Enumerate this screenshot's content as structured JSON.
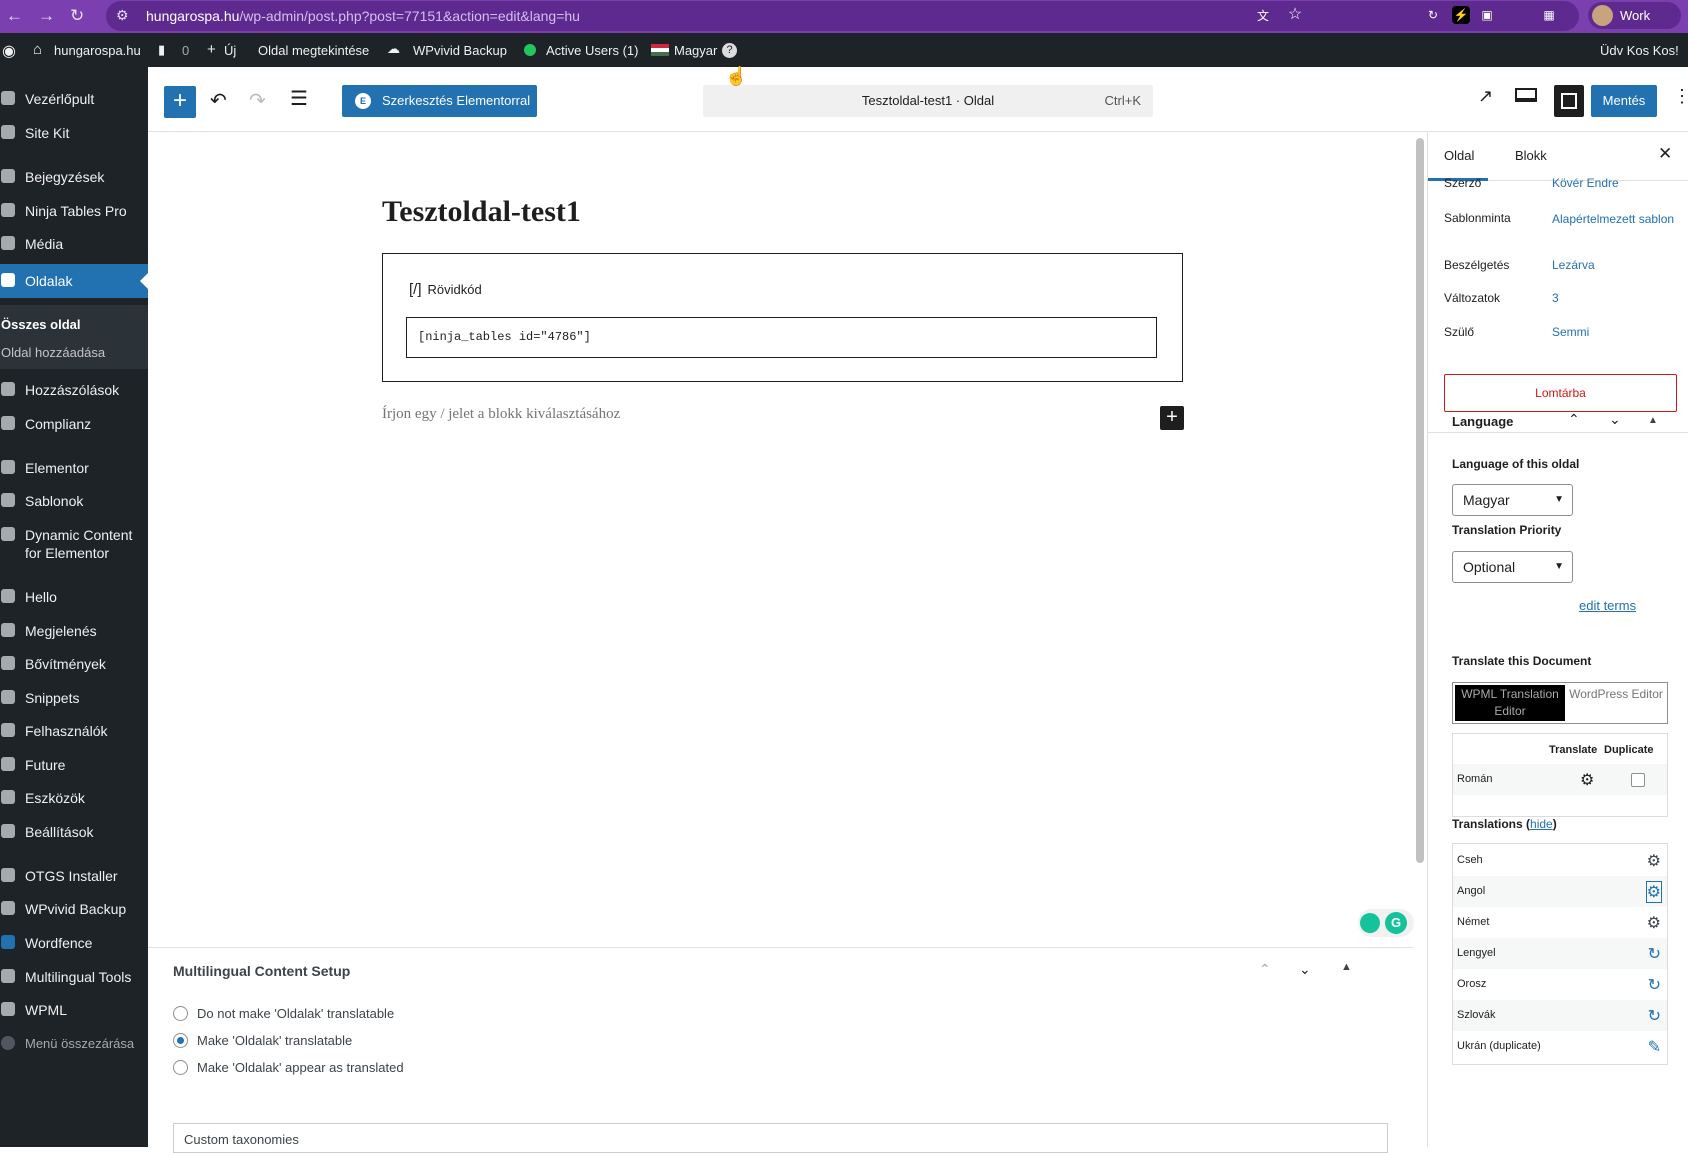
{
  "browser": {
    "url_domain": "hungarospa.hu",
    "url_path": "/wp-admin/post.php?post=77151&action=edit&lang=hu",
    "profile_label": "Work"
  },
  "adminbar": {
    "site_name": "hungarospa.hu",
    "comments_count": "0",
    "new_label": "Új",
    "view_page": "Oldal megtekintése",
    "backup": "WPvivid Backup",
    "active_users": "Active Users (1)",
    "language": "Magyar",
    "greeting": "Üdv Kos Kos!"
  },
  "sidebar": {
    "items": [
      {
        "label": "Vezérlőpult"
      },
      {
        "label": "Site Kit"
      },
      {
        "label": "Bejegyzések"
      },
      {
        "label": "Ninja Tables Pro"
      },
      {
        "label": "Média"
      },
      {
        "label": "Oldalak"
      },
      {
        "label": "Hozzászólások"
      },
      {
        "label": "Complianz"
      },
      {
        "label": "Elementor"
      },
      {
        "label": "Sablonok"
      },
      {
        "label": "Dynamic Content"
      },
      {
        "label": "Hello"
      },
      {
        "label": "Megjelenés"
      },
      {
        "label": "Bővítmények"
      },
      {
        "label": "Snippets"
      },
      {
        "label": "Felhasználók"
      },
      {
        "label": "Future"
      },
      {
        "label": "Eszközök"
      },
      {
        "label": "Beállítások"
      },
      {
        "label": "OTGS Installer"
      },
      {
        "label": "WPvivid Backup"
      },
      {
        "label": "Wordfence"
      },
      {
        "label": "Multilingual Tools"
      },
      {
        "label": "WPML"
      },
      {
        "label": "Menü összezárása"
      }
    ],
    "dynamic_line2": "for Elementor",
    "submenu": {
      "all_pages": "Összes oldal",
      "add_page": "Oldal hozzáadása"
    }
  },
  "toolbar": {
    "elementor_label": "Szerkesztés Elementorral",
    "doc_title": "Tesztoldal-test1 · Oldal",
    "shortcut": "Ctrl+K",
    "save_label": "Mentés"
  },
  "editor": {
    "page_title": "Tesztoldal-test1",
    "block_label": "Rövidkód",
    "shortcode": "[ninja_tables id=\"4786\"]",
    "placeholder": "Írjon egy / jelet a blokk kiválasztásához"
  },
  "meta": {
    "title": "Multilingual Content Setup",
    "options": [
      {
        "label": "Do not make 'Oldalak' translatable",
        "selected": false
      },
      {
        "label": "Make 'Oldalak' translatable",
        "selected": true
      },
      {
        "label": "Make 'Oldalak' appear as translated",
        "selected": false
      }
    ],
    "custom_taxonomies": "Custom taxonomies"
  },
  "panel": {
    "tab_page": "Oldal",
    "tab_block": "Blokk",
    "rows": [
      {
        "label": "Szerző",
        "value": "Kövér Endre"
      },
      {
        "label": "Sablonminta",
        "value": "Alapértelmezett sablon"
      },
      {
        "label": "Beszélgetés",
        "value": "Lezárva"
      },
      {
        "label": "Változatok",
        "value": "3"
      },
      {
        "label": "Szülő",
        "value": "Semmi"
      }
    ],
    "trash_label": "Lomtárba",
    "language_title": "Language",
    "language_of": "Language of this oldal",
    "language_value": "Magyar",
    "priority_title": "Translation Priority",
    "priority_value": "Optional",
    "edit_terms": "edit terms",
    "translate_doc": "Translate this Document",
    "seg_wpml": "WPML Translation Editor",
    "seg_wp": "WordPress Editor",
    "col_translate": "Translate",
    "col_duplicate": "Duplicate",
    "roman": "Román",
    "translations_label": "Translations",
    "hide_label": "hide",
    "translations": [
      {
        "name": "Cseh",
        "icon": "gear-icon"
      },
      {
        "name": "Angol",
        "icon": "gear-icon"
      },
      {
        "name": "Német",
        "icon": "gear-icon"
      },
      {
        "name": "Lengyel",
        "icon": "refresh-icon"
      },
      {
        "name": "Orosz",
        "icon": "refresh-icon"
      },
      {
        "name": "Szlovák",
        "icon": "refresh-icon"
      },
      {
        "name": "Ukrán (duplicate)",
        "icon": "pencil-icon"
      }
    ]
  }
}
